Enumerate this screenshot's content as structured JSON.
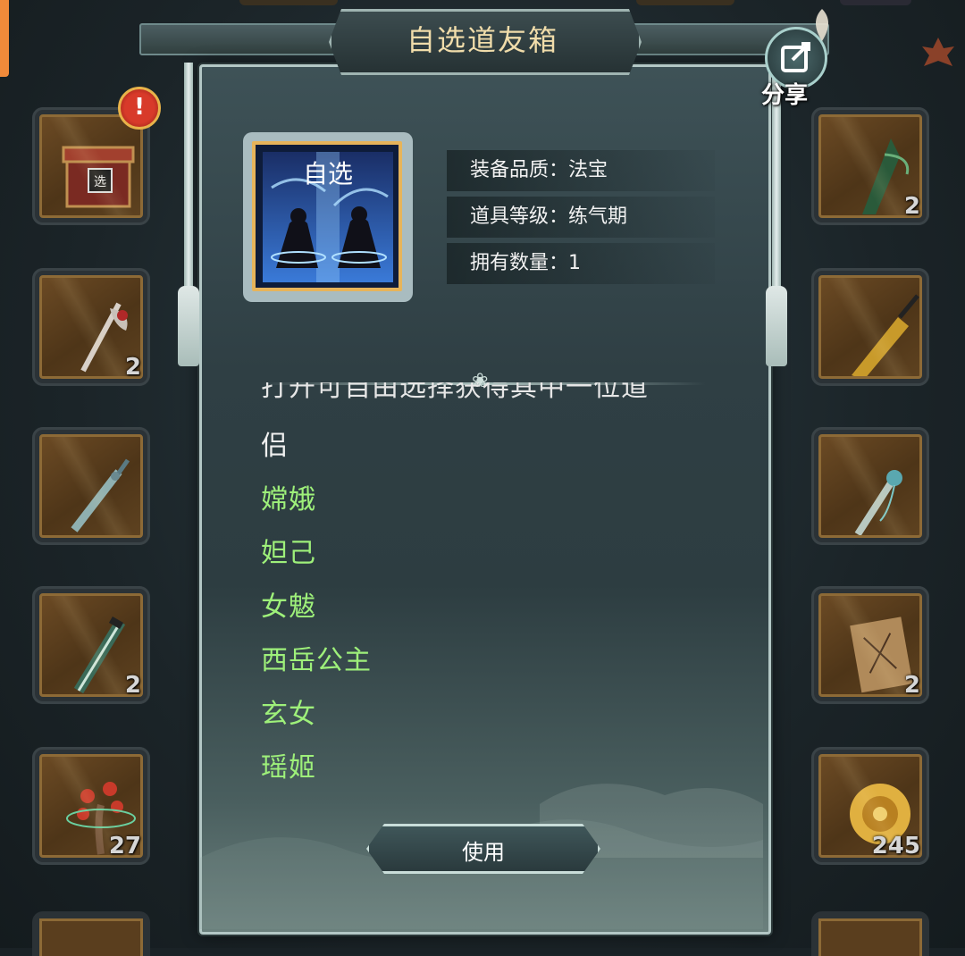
{
  "dialog": {
    "title": "自选道友箱",
    "share_label": "分享",
    "stats": [
      {
        "label": "装备品质：",
        "value": "法宝"
      },
      {
        "label": "道具等级：",
        "value": "练气期"
      },
      {
        "label": "拥有数量：",
        "value": "1"
      }
    ],
    "item_art_text": "自选",
    "description_clipped": "打开可自由选择获得其中一位道",
    "description_tail": "侣",
    "options": [
      "嫦娥",
      "妲己",
      "女魃",
      "西岳公主",
      "玄女",
      "瑶姬"
    ],
    "use_button": "使用"
  },
  "inventory_left": [
    {
      "icon": "chest-icon",
      "count": "",
      "badge": "!"
    },
    {
      "icon": "halberd-icon",
      "count": "2"
    },
    {
      "icon": "sword-icon",
      "count": ""
    },
    {
      "icon": "jade-sword-icon",
      "count": "2"
    },
    {
      "icon": "flower-tree-icon",
      "count": "27"
    }
  ],
  "inventory_right": [
    {
      "icon": "green-blade-icon",
      "count": "2"
    },
    {
      "icon": "gold-sword-icon",
      "count": ""
    },
    {
      "icon": "tassel-sword-icon",
      "count": ""
    },
    {
      "icon": "scroll-icon",
      "count": "2"
    },
    {
      "icon": "gold-dragon-icon",
      "count": "245"
    }
  ],
  "colors": {
    "option_green": "#9ef07a",
    "title_gold": "#f0dcaa",
    "slot_frame": "#8d6a36"
  }
}
